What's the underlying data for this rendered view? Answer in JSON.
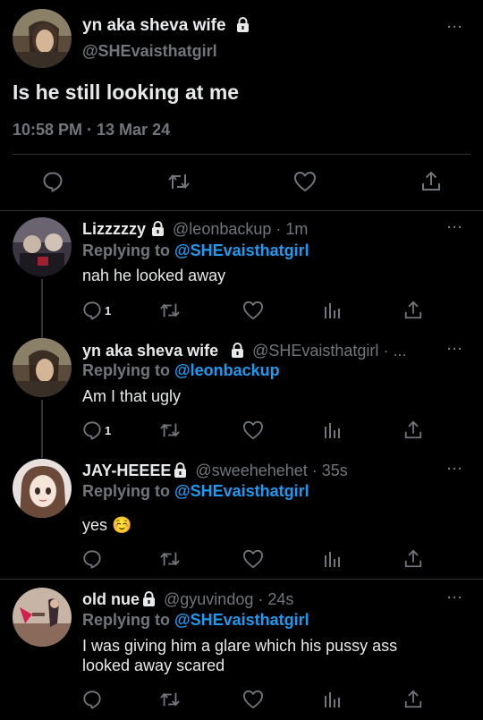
{
  "main_tweet": {
    "display_name": "yn aka sheva wife",
    "handle": "@SHEvaisthatgirl",
    "text": "Is he still looking at me",
    "timestamp": "10:58 PM · 13 Mar 24",
    "more": "···"
  },
  "replies": [
    {
      "display_name": "Lizzzzzy",
      "handle": "@leonbackup",
      "time": "· 1m",
      "replying_prefix": "Replying to",
      "replying_to": "@SHEvaisthatgirl",
      "text": "nah he looked away",
      "reply_count": "1",
      "more": "···"
    },
    {
      "display_name": "yn aka sheva wife",
      "handle": "@SHEvaisthatgirl",
      "time": "· ...",
      "replying_prefix": "Replying to",
      "replying_to": "@leonbackup",
      "text": "Am I that ugly",
      "reply_count": "1",
      "more": "···"
    },
    {
      "display_name": "JAY-HEEEE",
      "handle": "@sweehehehet",
      "time": "· 35s",
      "replying_prefix": "Replying to",
      "replying_to": "@SHEvaisthatgirl",
      "text": "yes ☺️",
      "reply_count": "",
      "more": "···"
    },
    {
      "display_name": "old nue",
      "handle": "@gyuvindog",
      "time": "· 24s",
      "replying_prefix": "Replying to",
      "replying_to": "@SHEvaisthatgirl",
      "text": "I was giving him a glare which his pussy ass looked away scared",
      "reply_count": "",
      "more": "···"
    }
  ],
  "icons": [
    "reply-icon",
    "retweet-icon",
    "like-icon",
    "views-icon",
    "share-icon",
    "lock-icon",
    "more-icon"
  ],
  "colors": {
    "background": "#000000",
    "text": "#e7e9ea",
    "secondary": "#71767b",
    "accent": "#1d9bf0",
    "divider": "#2f3336"
  }
}
